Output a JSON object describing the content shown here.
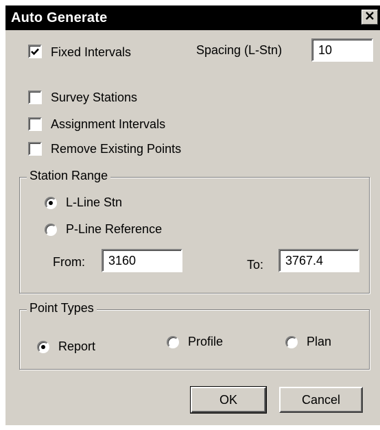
{
  "window": {
    "title": "Auto Generate",
    "close_glyph": "✕"
  },
  "options": {
    "fixed_intervals": {
      "label": "Fixed Intervals",
      "checked": true
    },
    "spacing": {
      "label": "Spacing (L-Stn)",
      "value": "10"
    },
    "survey_stations": {
      "label": "Survey Stations",
      "checked": false
    },
    "assignment_intervals": {
      "label": "Assignment Intervals",
      "checked": false
    },
    "remove_existing_points": {
      "label": "Remove Existing Points",
      "checked": false
    }
  },
  "station_range": {
    "title": "Station Range",
    "l_line_stn": {
      "label": "L-Line Stn",
      "selected": true
    },
    "p_line_reference": {
      "label": "P-Line Reference",
      "selected": false
    },
    "from": {
      "label": "From:",
      "value": "3160"
    },
    "to": {
      "label": "To:",
      "value": "3767.4"
    }
  },
  "point_types": {
    "title": "Point Types",
    "report": {
      "label": "Report",
      "selected": true
    },
    "profile": {
      "label": "Profile",
      "selected": false
    },
    "plan": {
      "label": "Plan",
      "selected": false
    }
  },
  "buttons": {
    "ok": "OK",
    "cancel": "Cancel"
  }
}
